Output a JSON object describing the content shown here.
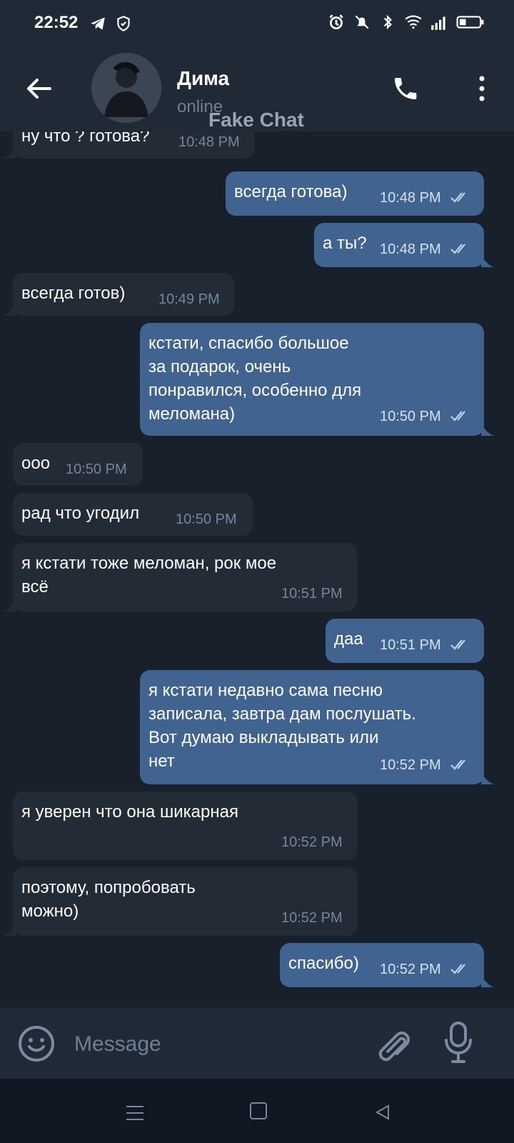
{
  "status": {
    "time": "22:52"
  },
  "chat": {
    "name": "Дима",
    "presence": "online",
    "watermark": "Fake Chat"
  },
  "messages": [
    {
      "dir": "in",
      "text": "ну что ? готова?",
      "time": "10:48 PM"
    },
    {
      "dir": "out",
      "text": "всегда готова)",
      "time": "10:48 PM"
    },
    {
      "dir": "out",
      "text": "а ты?",
      "time": "10:48 PM"
    },
    {
      "dir": "in",
      "text": "всегда готов)",
      "time": "10:49 PM"
    },
    {
      "dir": "out",
      "text": "кстати, спасибо большое\nза подарок, очень\nпонравился, особенно для\nмеломана)",
      "time": "10:50 PM"
    },
    {
      "dir": "in",
      "text": "ооо",
      "time": "10:50 PM"
    },
    {
      "dir": "in",
      "text": "рад что угодил",
      "time": "10:50 PM"
    },
    {
      "dir": "in",
      "text": "я кстати тоже меломан, рок мое\nвсё",
      "time": "10:51 PM"
    },
    {
      "dir": "out",
      "text": "даа",
      "time": "10:51 PM"
    },
    {
      "dir": "out",
      "text": "я кстати недавно сама песню\nзаписала, завтра дам послушать.\nВот думаю выкладывать или\nнет",
      "time": "10:52 PM"
    },
    {
      "dir": "in",
      "text": "я уверен что она шикарная",
      "time": "10:52 PM"
    },
    {
      "dir": "in",
      "text": "поэтому, попробовать\nможно)",
      "time": "10:52 PM"
    },
    {
      "dir": "out",
      "text": "спасибо)",
      "time": "10:52 PM"
    }
  ],
  "composer": {
    "placeholder": "Message"
  },
  "icons": {
    "back": "arrow-left",
    "call": "phone",
    "more": "vertical-dots",
    "emoji": "smile",
    "attach": "paperclip",
    "mic": "microphone",
    "read": "double-check"
  },
  "colors": {
    "incoming_bubble": "#222b36",
    "outgoing_bubble": "#41638f",
    "background": "#18202c",
    "header": "#202a36"
  }
}
